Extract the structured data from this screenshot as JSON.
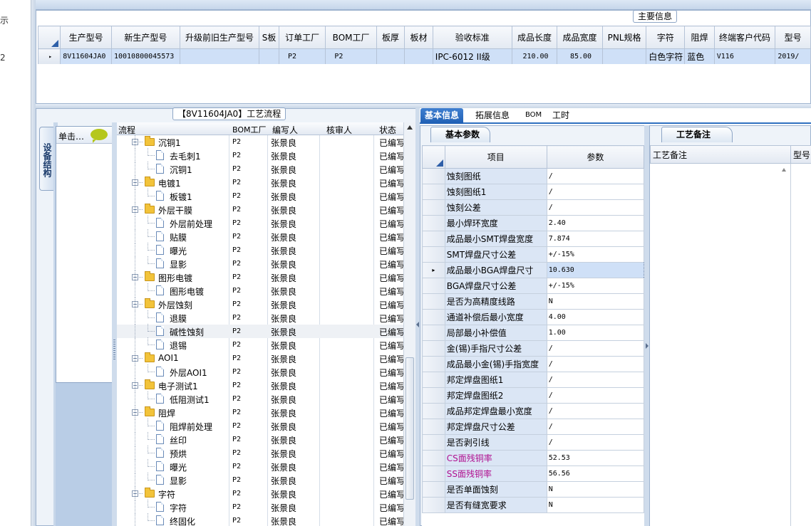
{
  "left_strip": {
    "text_1": "示",
    "text_2": "2"
  },
  "main_info": {
    "legend": "主要信息",
    "columns": [
      "生产型号",
      "新生产型号",
      "升级前旧生产型号",
      "S板",
      "订单工厂",
      "BOM工厂",
      "板厚",
      "板材",
      "验收标准",
      "成品长度",
      "成品宽度",
      "PNL规格",
      "字符",
      "阻焊",
      "终端客户代码",
      "型号"
    ],
    "row": [
      "8V11604JA0",
      "10010800045573",
      "",
      "",
      "P2",
      "P2",
      "",
      "",
      "IPC-6012 II级",
      "210.00",
      "85.00",
      "",
      "白色字符",
      "蓝色",
      "V116",
      "2019/"
    ],
    "row_marker": "▸"
  },
  "process": {
    "legend": "【8V11604JA0】工艺流程",
    "side_tab": "设备结构",
    "device_header": "单击…",
    "tree_columns": [
      "流程",
      "BOM工厂",
      "编写人",
      "核审人",
      "状态"
    ],
    "rows": [
      {
        "level": 1,
        "name": "沉铜1",
        "bom": "P2",
        "writer": "张景良",
        "status": "已编写"
      },
      {
        "level": 2,
        "name": "去毛刺1",
        "bom": "P2",
        "writer": "张景良",
        "status": "已编写"
      },
      {
        "level": 2,
        "name": "沉铜1",
        "bom": "P2",
        "writer": "张景良",
        "status": "已编写"
      },
      {
        "level": 1,
        "name": "电镀1",
        "bom": "P2",
        "writer": "张景良",
        "status": "已编写"
      },
      {
        "level": 2,
        "name": "板镀1",
        "bom": "P2",
        "writer": "张景良",
        "status": "已编写"
      },
      {
        "level": 1,
        "name": "外层干膜",
        "bom": "P2",
        "writer": "张景良",
        "status": "已编写"
      },
      {
        "level": 2,
        "name": "外层前处理",
        "bom": "P2",
        "writer": "张景良",
        "status": "已编写"
      },
      {
        "level": 2,
        "name": "贴膜",
        "bom": "P2",
        "writer": "张景良",
        "status": "已编写"
      },
      {
        "level": 2,
        "name": "曝光",
        "bom": "P2",
        "writer": "张景良",
        "status": "已编写"
      },
      {
        "level": 2,
        "name": "显影",
        "bom": "P2",
        "writer": "张景良",
        "status": "已编写"
      },
      {
        "level": 1,
        "name": "图形电镀",
        "bom": "P2",
        "writer": "张景良",
        "status": "已编写"
      },
      {
        "level": 2,
        "name": "图形电镀",
        "bom": "P2",
        "writer": "张景良",
        "status": "已编写"
      },
      {
        "level": 1,
        "name": "外层蚀刻",
        "bom": "P2",
        "writer": "张景良",
        "status": "已编写"
      },
      {
        "level": 2,
        "name": "退膜",
        "bom": "P2",
        "writer": "张景良",
        "status": "已编写"
      },
      {
        "level": 2,
        "name": "碱性蚀刻",
        "bom": "P2",
        "writer": "张景良",
        "status": "已编写"
      },
      {
        "level": 2,
        "name": "退锡",
        "bom": "P2",
        "writer": "张景良",
        "status": "已编写"
      },
      {
        "level": 1,
        "name": "AOI1",
        "bom": "P2",
        "writer": "张景良",
        "status": "已编写"
      },
      {
        "level": 2,
        "name": "外层AOI1",
        "bom": "P2",
        "writer": "张景良",
        "status": "已编写"
      },
      {
        "level": 1,
        "name": "电子测试1",
        "bom": "P2",
        "writer": "张景良",
        "status": "已编写"
      },
      {
        "level": 2,
        "name": "低阻测试1",
        "bom": "P2",
        "writer": "张景良",
        "status": "已编写"
      },
      {
        "level": 1,
        "name": "阻焊",
        "bom": "P2",
        "writer": "张景良",
        "status": "已编写"
      },
      {
        "level": 2,
        "name": "阻焊前处理",
        "bom": "P2",
        "writer": "张景良",
        "status": "已编写"
      },
      {
        "level": 2,
        "name": "丝印",
        "bom": "P2",
        "writer": "张景良",
        "status": "已编写"
      },
      {
        "level": 2,
        "name": "预烘",
        "bom": "P2",
        "writer": "张景良",
        "status": "已编写"
      },
      {
        "level": 2,
        "name": "曝光",
        "bom": "P2",
        "writer": "张景良",
        "status": "已编写"
      },
      {
        "level": 2,
        "name": "显影",
        "bom": "P2",
        "writer": "张景良",
        "status": "已编写"
      },
      {
        "level": 1,
        "name": "字符",
        "bom": "P2",
        "writer": "张景良",
        "status": "已编写"
      },
      {
        "level": 2,
        "name": "字符",
        "bom": "P2",
        "writer": "张景良",
        "status": "已编写"
      },
      {
        "level": 2,
        "name": "终固化",
        "bom": "P2",
        "writer": "张景良",
        "status": "已编写"
      }
    ]
  },
  "tabs": [
    "基本信息",
    "拓展信息",
    "BOM",
    "工时"
  ],
  "basic": {
    "panel_title": "基本参数",
    "columns": [
      "项目",
      "参数"
    ],
    "rows": [
      {
        "key": "蚀刻图纸",
        "val": "/"
      },
      {
        "key": "蚀刻图纸1",
        "val": "/"
      },
      {
        "key": "蚀刻公差",
        "val": "/"
      },
      {
        "key": "最小焊环宽度",
        "val": "2.40"
      },
      {
        "key": "成品最小SMT焊盘宽度",
        "val": "7.874"
      },
      {
        "key": "SMT焊盘尺寸公差",
        "val": "+/-15%"
      },
      {
        "key": "成品最小BGA焊盘尺寸",
        "val": "10.630",
        "selected": true
      },
      {
        "key": "BGA焊盘尺寸公差",
        "val": "+/-15%"
      },
      {
        "key": "是否为高精度线路",
        "val": "N"
      },
      {
        "key": "通道补偿后最小宽度",
        "val": "4.00"
      },
      {
        "key": "局部最小补偿值",
        "val": "1.00"
      },
      {
        "key": "金(锡)手指尺寸公差",
        "val": "/"
      },
      {
        "key": "成品最小金(锡)手指宽度",
        "val": "/"
      },
      {
        "key": "邦定焊盘图纸1",
        "val": "/"
      },
      {
        "key": "邦定焊盘图纸2",
        "val": "/"
      },
      {
        "key": "成品邦定焊盘最小宽度",
        "val": "/"
      },
      {
        "key": "邦定焊盘尺寸公差",
        "val": "/"
      },
      {
        "key": "是否剥引线",
        "val": "/"
      },
      {
        "key": "CS面残铜率",
        "val": "52.53",
        "pink": true
      },
      {
        "key": "SS面残铜率",
        "val": "56.56",
        "pink": true
      },
      {
        "key": "是否单面蚀刻",
        "val": "N"
      },
      {
        "key": "是否有缝宽要求",
        "val": "N"
      }
    ],
    "row_marker": "▸"
  },
  "notes": {
    "panel_title": "工艺备注",
    "columns": [
      "工艺备注",
      "型号"
    ]
  },
  "colors": {
    "accent": "#1f5fb4",
    "selection": "#cfe0f7",
    "key_bg": "#dbe6f5",
    "pink": "#b01090"
  }
}
